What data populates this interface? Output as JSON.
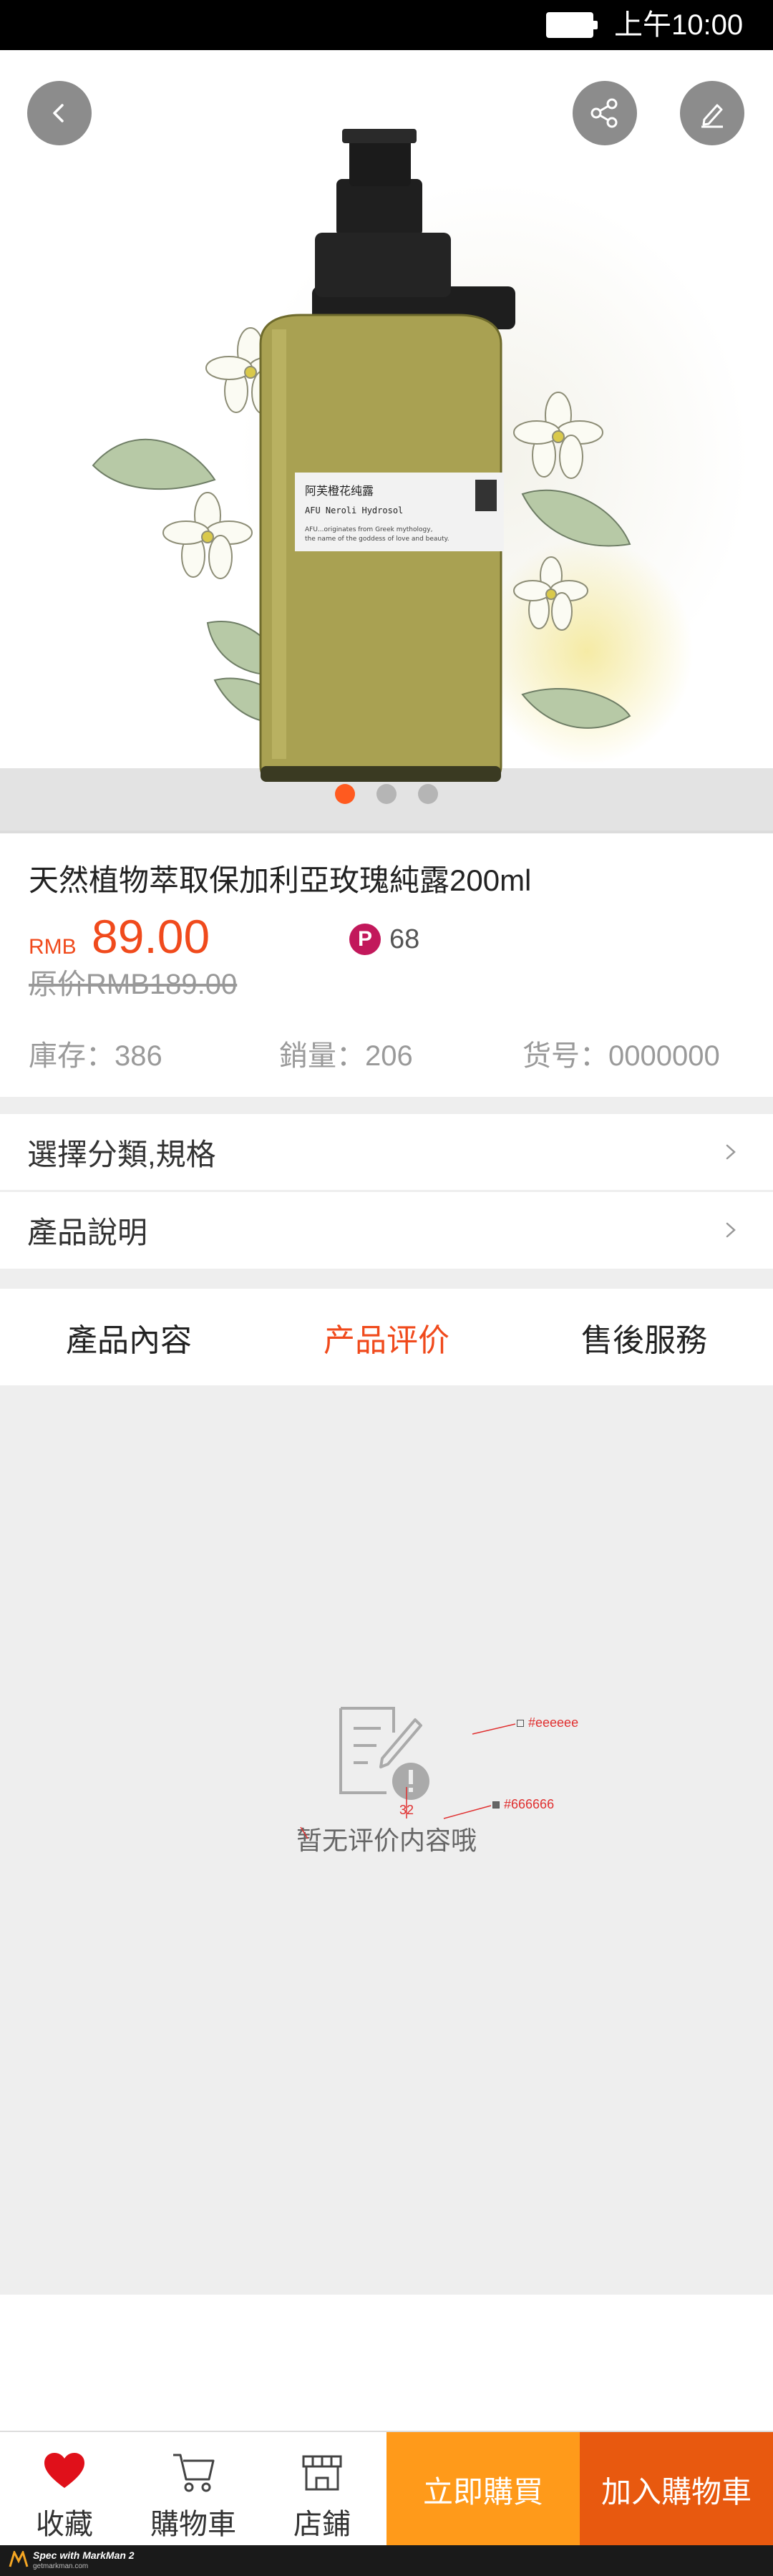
{
  "status_bar": {
    "time": "上午10:00"
  },
  "hero": {
    "slide_count": 3,
    "active_slide": 1,
    "bottle_label_title": "阿芙橙花纯露",
    "bottle_label_subtitle": "AFU Neroli Hydrosol",
    "bottle_label_line1": "AFU...originates from Greek mythology,",
    "bottle_label_line2": "the name of the goddess of love and beauty."
  },
  "product": {
    "title": "天然植物萃取保加利亞玫瑰純露200ml",
    "price_currency": "RMB",
    "price": "89.00",
    "points_icon_letter": "P",
    "points": "68",
    "original_price": "原价RMB189.00",
    "stock": "庫存：386",
    "sales": "銷量：206",
    "item_no": "货号：0000000"
  },
  "options": {
    "spec_label": "選擇分類,規格",
    "desc_label": "產品說明"
  },
  "tabs": [
    {
      "label": "產品內容"
    },
    {
      "label": "产品评价"
    },
    {
      "label": "售後服務"
    }
  ],
  "active_tab": 1,
  "review": {
    "empty_text": "暂无评价内容哦",
    "spec_bg_color": "#eeeeee",
    "spec_text_color": "#666666",
    "spec_size": "32"
  },
  "bottom_bar": {
    "favorite_label": "收藏",
    "cart_label": "購物車",
    "store_label": "店鋪",
    "buy_now_label": "立即購買",
    "add_to_cart_label": "加入購物車"
  },
  "footer": {
    "brand_text": "Spec with MarkMan 2",
    "url": "getmarkman.com"
  },
  "colors": {
    "accent": "#f04a1c",
    "buy_now": "#ff9a1a",
    "add_to_cart": "#e8590f",
    "favorite_heart": "#e0101a",
    "points_badge": "#c2185b"
  }
}
